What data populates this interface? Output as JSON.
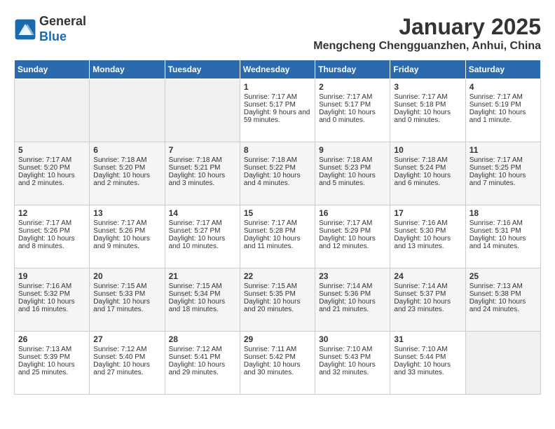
{
  "header": {
    "logo_line1": "General",
    "logo_line2": "Blue",
    "month_title": "January 2025",
    "location": "Mengcheng Chengguanzhen, Anhui, China"
  },
  "days_of_week": [
    "Sunday",
    "Monday",
    "Tuesday",
    "Wednesday",
    "Thursday",
    "Friday",
    "Saturday"
  ],
  "weeks": [
    [
      {
        "day": "",
        "info": ""
      },
      {
        "day": "",
        "info": ""
      },
      {
        "day": "",
        "info": ""
      },
      {
        "day": "1",
        "info": "Sunrise: 7:17 AM\nSunset: 5:17 PM\nDaylight: 9 hours and 59 minutes."
      },
      {
        "day": "2",
        "info": "Sunrise: 7:17 AM\nSunset: 5:17 PM\nDaylight: 10 hours and 0 minutes."
      },
      {
        "day": "3",
        "info": "Sunrise: 7:17 AM\nSunset: 5:18 PM\nDaylight: 10 hours and 0 minutes."
      },
      {
        "day": "4",
        "info": "Sunrise: 7:17 AM\nSunset: 5:19 PM\nDaylight: 10 hours and 1 minute."
      }
    ],
    [
      {
        "day": "5",
        "info": "Sunrise: 7:17 AM\nSunset: 5:20 PM\nDaylight: 10 hours and 2 minutes."
      },
      {
        "day": "6",
        "info": "Sunrise: 7:18 AM\nSunset: 5:20 PM\nDaylight: 10 hours and 2 minutes."
      },
      {
        "day": "7",
        "info": "Sunrise: 7:18 AM\nSunset: 5:21 PM\nDaylight: 10 hours and 3 minutes."
      },
      {
        "day": "8",
        "info": "Sunrise: 7:18 AM\nSunset: 5:22 PM\nDaylight: 10 hours and 4 minutes."
      },
      {
        "day": "9",
        "info": "Sunrise: 7:18 AM\nSunset: 5:23 PM\nDaylight: 10 hours and 5 minutes."
      },
      {
        "day": "10",
        "info": "Sunrise: 7:18 AM\nSunset: 5:24 PM\nDaylight: 10 hours and 6 minutes."
      },
      {
        "day": "11",
        "info": "Sunrise: 7:17 AM\nSunset: 5:25 PM\nDaylight: 10 hours and 7 minutes."
      }
    ],
    [
      {
        "day": "12",
        "info": "Sunrise: 7:17 AM\nSunset: 5:26 PM\nDaylight: 10 hours and 8 minutes."
      },
      {
        "day": "13",
        "info": "Sunrise: 7:17 AM\nSunset: 5:26 PM\nDaylight: 10 hours and 9 minutes."
      },
      {
        "day": "14",
        "info": "Sunrise: 7:17 AM\nSunset: 5:27 PM\nDaylight: 10 hours and 10 minutes."
      },
      {
        "day": "15",
        "info": "Sunrise: 7:17 AM\nSunset: 5:28 PM\nDaylight: 10 hours and 11 minutes."
      },
      {
        "day": "16",
        "info": "Sunrise: 7:17 AM\nSunset: 5:29 PM\nDaylight: 10 hours and 12 minutes."
      },
      {
        "day": "17",
        "info": "Sunrise: 7:16 AM\nSunset: 5:30 PM\nDaylight: 10 hours and 13 minutes."
      },
      {
        "day": "18",
        "info": "Sunrise: 7:16 AM\nSunset: 5:31 PM\nDaylight: 10 hours and 14 minutes."
      }
    ],
    [
      {
        "day": "19",
        "info": "Sunrise: 7:16 AM\nSunset: 5:32 PM\nDaylight: 10 hours and 16 minutes."
      },
      {
        "day": "20",
        "info": "Sunrise: 7:15 AM\nSunset: 5:33 PM\nDaylight: 10 hours and 17 minutes."
      },
      {
        "day": "21",
        "info": "Sunrise: 7:15 AM\nSunset: 5:34 PM\nDaylight: 10 hours and 18 minutes."
      },
      {
        "day": "22",
        "info": "Sunrise: 7:15 AM\nSunset: 5:35 PM\nDaylight: 10 hours and 20 minutes."
      },
      {
        "day": "23",
        "info": "Sunrise: 7:14 AM\nSunset: 5:36 PM\nDaylight: 10 hours and 21 minutes."
      },
      {
        "day": "24",
        "info": "Sunrise: 7:14 AM\nSunset: 5:37 PM\nDaylight: 10 hours and 23 minutes."
      },
      {
        "day": "25",
        "info": "Sunrise: 7:13 AM\nSunset: 5:38 PM\nDaylight: 10 hours and 24 minutes."
      }
    ],
    [
      {
        "day": "26",
        "info": "Sunrise: 7:13 AM\nSunset: 5:39 PM\nDaylight: 10 hours and 25 minutes."
      },
      {
        "day": "27",
        "info": "Sunrise: 7:12 AM\nSunset: 5:40 PM\nDaylight: 10 hours and 27 minutes."
      },
      {
        "day": "28",
        "info": "Sunrise: 7:12 AM\nSunset: 5:41 PM\nDaylight: 10 hours and 29 minutes."
      },
      {
        "day": "29",
        "info": "Sunrise: 7:11 AM\nSunset: 5:42 PM\nDaylight: 10 hours and 30 minutes."
      },
      {
        "day": "30",
        "info": "Sunrise: 7:10 AM\nSunset: 5:43 PM\nDaylight: 10 hours and 32 minutes."
      },
      {
        "day": "31",
        "info": "Sunrise: 7:10 AM\nSunset: 5:44 PM\nDaylight: 10 hours and 33 minutes."
      },
      {
        "day": "",
        "info": ""
      }
    ]
  ]
}
